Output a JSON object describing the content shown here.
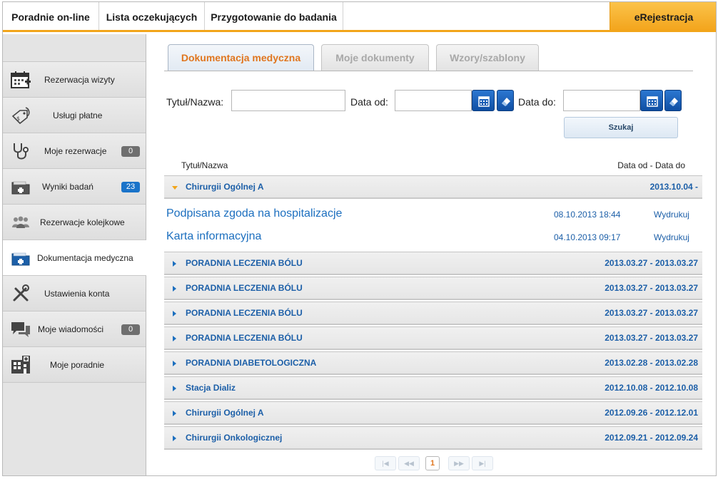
{
  "topnav": {
    "tabs": [
      "Poradnie on-line",
      "Lista oczekujących",
      "Przygotowanie do badania"
    ],
    "ereg": "eRejestracja"
  },
  "sidebar": {
    "items": [
      {
        "label": "Rezerwacja wizyty",
        "icon": "calendar-plus-icon"
      },
      {
        "label": "Usługi płatne",
        "icon": "price-tag-stethoscope-icon"
      },
      {
        "label": "Moje rezerwacje",
        "icon": "stethoscope-icon",
        "badge": "0"
      },
      {
        "label": "Wyniki badań",
        "icon": "medical-folder-icon",
        "badge": "23"
      },
      {
        "label": "Rezerwacje kolejkowe",
        "icon": "people-queue-icon"
      },
      {
        "label": "Dokumentacja medyczna",
        "icon": "medical-folder-icon"
      },
      {
        "label": "Ustawienia konta",
        "icon": "tools-icon"
      },
      {
        "label": "Moje wiadomości",
        "icon": "chat-bubbles-icon",
        "badge": "0"
      },
      {
        "label": "Moje poradnie",
        "icon": "hospital-building-icon"
      }
    ],
    "active": "Dokumentacja medyczna"
  },
  "subtabs": [
    "Dokumentacja medyczna",
    "Moje dokumenty",
    "Wzory/szablony"
  ],
  "filters": {
    "title_label": "Tytuł/Nazwa:",
    "date_from_label": "Data od:",
    "date_to_label": "Data do:",
    "search_button": "Szukaj"
  },
  "list": {
    "header_title": "Tytuł/Nazwa",
    "header_dates": "Data od - Data do",
    "expanded_group": {
      "name": "Chirurgii Ogólnej A",
      "dates": "2013.10.04 -"
    },
    "documents": [
      {
        "title": "Podpisana zgoda na hospitalizacje",
        "date": "08.10.2013 18:44",
        "action": "Wydrukuj"
      },
      {
        "title": "Karta informacyjna",
        "date": "04.10.2013 09:17",
        "action": "Wydrukuj"
      }
    ],
    "groups": [
      {
        "name": "PORADNIA LECZENIA BÓLU",
        "dates": "2013.03.27 - 2013.03.27"
      },
      {
        "name": "PORADNIA LECZENIA BÓLU",
        "dates": "2013.03.27 - 2013.03.27"
      },
      {
        "name": "PORADNIA LECZENIA BÓLU",
        "dates": "2013.03.27 - 2013.03.27"
      },
      {
        "name": "PORADNIA LECZENIA BÓLU",
        "dates": "2013.03.27 - 2013.03.27"
      },
      {
        "name": "PORADNIA DIABETOLOGICZNA",
        "dates": "2013.02.28 - 2013.02.28"
      },
      {
        "name": "Stacja Dializ",
        "dates": "2012.10.08 - 2012.10.08"
      },
      {
        "name": "Chirurgii Ogólnej A",
        "dates": "2012.09.26 - 2012.12.01"
      },
      {
        "name": "Chirurgii Onkologicznej",
        "dates": "2012.09.21 - 2012.09.24"
      }
    ]
  },
  "pager": {
    "first": "|◀",
    "prev": "◀◀",
    "current": "1",
    "next": "▶▶",
    "last": "▶|"
  },
  "colors": {
    "accent": "#f2a51a",
    "link": "#1c6fbf",
    "active_tab": "#e0761f"
  }
}
